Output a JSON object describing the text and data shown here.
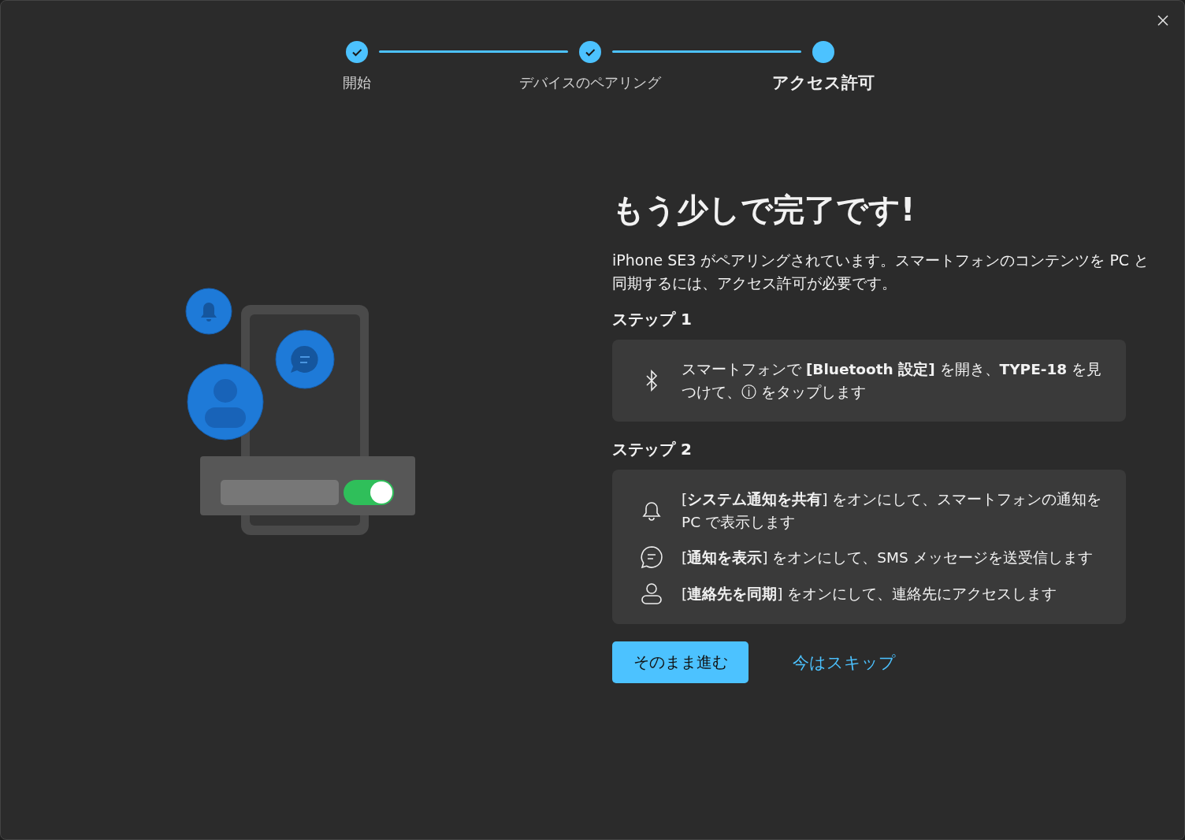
{
  "stepper": [
    {
      "label": "開始",
      "done": true,
      "selected": false
    },
    {
      "label": "デバイスのペアリング",
      "done": true,
      "selected": false
    },
    {
      "label": "アクセス許可",
      "done": false,
      "selected": true
    }
  ],
  "heading": "もう少しで完了です!",
  "description": "iPhone SE3 がペアリングされています。スマートフォンのコンテンツを PC と同期するには、アクセス許可が必要です。",
  "sections": [
    {
      "title": "ステップ 1",
      "items": [
        {
          "kind": "bluetooth",
          "text": "スマートフォンで **[Bluetooth 設定]** を開き、**TYPE-18** を見つけて、ⓘ をタップします"
        }
      ]
    },
    {
      "title": "ステップ 2",
      "items": [
        {
          "kind": "bell",
          "text": "[**システム通知を共有**] をオンにして、スマートフォンの通知を PC で表示します"
        },
        {
          "kind": "chat",
          "text": "[**通知を表示**] をオンにして、SMS メッセージを送受信します"
        },
        {
          "kind": "person",
          "text": "[**連絡先を同期**] をオンにして、連絡先にアクセスします"
        }
      ]
    }
  ],
  "buttons": {
    "primary": "そのまま進む",
    "link": "今はスキップ"
  }
}
